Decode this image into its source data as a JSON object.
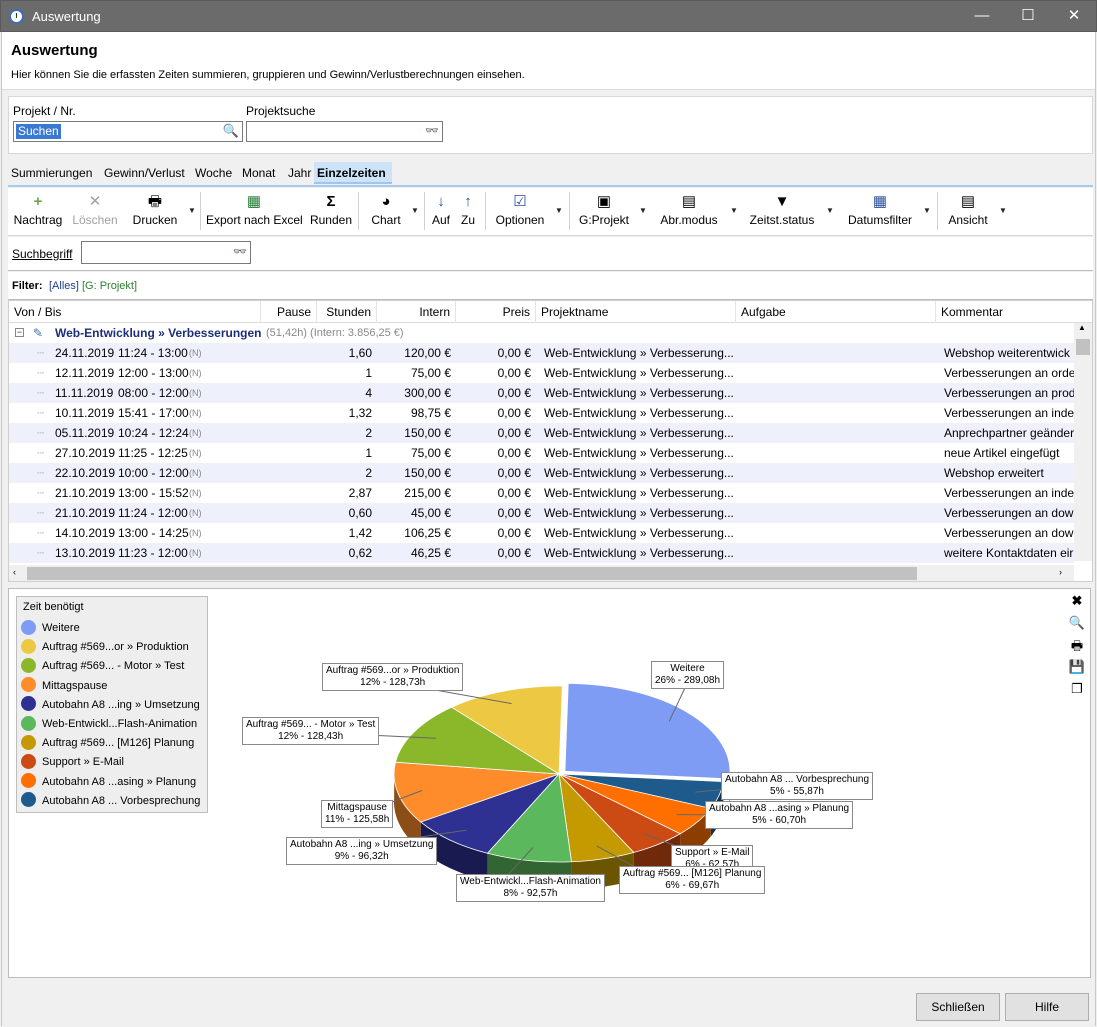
{
  "window": {
    "title": "Auswertung",
    "minimize": "—",
    "maximize": "☐",
    "close": "✕"
  },
  "header": {
    "title": "Auswertung",
    "subtitle": "Hier können Sie die erfassten Zeiten summieren, gruppieren und Gewinn/Verlustberechnungen einsehen."
  },
  "project": {
    "nr_label": "Projekt / Nr.",
    "nr_value": "Suchen",
    "search_label": "Projektsuche",
    "search_value": ""
  },
  "tabs": [
    "Summierungen",
    "Gewinn/Verlust",
    "Woche",
    "Monat",
    "Jahr",
    "Einzelzeiten"
  ],
  "active_tab": "Einzelzeiten",
  "toolbar": {
    "nachtrag": "Nachtrag",
    "loeschen": "Löschen",
    "drucken": "Drucken",
    "export": "Export nach Excel",
    "runden": "Runden",
    "chart": "Chart",
    "auf": "Auf",
    "zu": "Zu",
    "optionen": "Optionen",
    "gprojekt": "G:Projekt",
    "abrmodus": "Abr.modus",
    "zeitststatus": "Zeitst.status",
    "datumsfilter": "Datumsfilter",
    "ansicht": "Ansicht"
  },
  "search": {
    "label": "Suchbegriff",
    "value": ""
  },
  "filter": {
    "label": "Filter:",
    "all": "[Alles]",
    "group": "[G: Projekt]"
  },
  "grid": {
    "columns": [
      "Von / Bis",
      "Pause",
      "Stunden",
      "Intern",
      "Preis",
      "Projektname",
      "Aufgabe",
      "Kommentar"
    ],
    "group": {
      "title": "Web-Entwicklung » Verbesserungen",
      "summary": "(51,42h) (Intern: 3.856,25 €)"
    },
    "rows": [
      {
        "date": "24.11.2019",
        "time": "11:24 - 13:00",
        "flag": "(N)",
        "stunden": "1,60",
        "intern": "120,00 €",
        "preis": "0,00 €",
        "projekt": "Web-Entwicklung » Verbesserung...",
        "kommentar": "Webshop weiterentwick"
      },
      {
        "date": "12.11.2019",
        "time": "12:00 - 13:00",
        "flag": "(N)",
        "stunden": "1",
        "intern": "75,00 €",
        "preis": "0,00 €",
        "projekt": "Web-Entwicklung » Verbesserung...",
        "kommentar": "Verbesserungen an order"
      },
      {
        "date": "11.11.2019",
        "time": "08:00 - 12:00",
        "flag": "(N)",
        "stunden": "4",
        "intern": "300,00 €",
        "preis": "0,00 €",
        "projekt": "Web-Entwicklung » Verbesserung...",
        "kommentar": "Verbesserungen an prod"
      },
      {
        "date": "10.11.2019",
        "time": "15:41 - 17:00",
        "flag": "(N)",
        "stunden": "1,32",
        "intern": "98,75 €",
        "preis": "0,00 €",
        "projekt": "Web-Entwicklung » Verbesserung...",
        "kommentar": "Verbesserungen an index"
      },
      {
        "date": "05.11.2019",
        "time": "10:24 - 12:24",
        "flag": "(N)",
        "stunden": "2",
        "intern": "150,00 €",
        "preis": "0,00 €",
        "projekt": "Web-Entwicklung » Verbesserung...",
        "kommentar": "Anprechpartner geänder"
      },
      {
        "date": "27.10.2019",
        "time": "11:25 - 12:25",
        "flag": "(N)",
        "stunden": "1",
        "intern": "75,00 €",
        "preis": "0,00 €",
        "projekt": "Web-Entwicklung » Verbesserung...",
        "kommentar": "neue Artikel eingefügt"
      },
      {
        "date": "22.10.2019",
        "time": "10:00 - 12:00",
        "flag": "(N)",
        "stunden": "2",
        "intern": "150,00 €",
        "preis": "0,00 €",
        "projekt": "Web-Entwicklung » Verbesserung...",
        "kommentar": "Webshop erweitert"
      },
      {
        "date": "21.10.2019",
        "time": "13:00 - 15:52",
        "flag": "(N)",
        "stunden": "2,87",
        "intern": "215,00 €",
        "preis": "0,00 €",
        "projekt": "Web-Entwicklung » Verbesserung...",
        "kommentar": "Verbesserungen an index"
      },
      {
        "date": "21.10.2019",
        "time": "11:24 - 12:00",
        "flag": "(N)",
        "stunden": "0,60",
        "intern": "45,00 €",
        "preis": "0,00 €",
        "projekt": "Web-Entwicklung » Verbesserung...",
        "kommentar": "Verbesserungen an down"
      },
      {
        "date": "14.10.2019",
        "time": "13:00 - 14:25",
        "flag": "(N)",
        "stunden": "1,42",
        "intern": "106,25 €",
        "preis": "0,00 €",
        "projekt": "Web-Entwicklung » Verbesserung...",
        "kommentar": "Verbesserungen an down"
      },
      {
        "date": "13.10.2019",
        "time": "11:23 - 12:00",
        "flag": "(N)",
        "stunden": "0,62",
        "intern": "46,25 €",
        "preis": "0,00 €",
        "projekt": "Web-Entwicklung » Verbesserung...",
        "kommentar": "weitere Kontaktdaten eir"
      }
    ]
  },
  "chart_data": {
    "type": "pie",
    "title": "Zeit benötigt",
    "legend": "left",
    "slices": [
      {
        "name": "Weitere",
        "label": "Weitere",
        "percent_text": "26% - 289,08h",
        "value": 289.08,
        "color": "#7f9cf5"
      },
      {
        "name": "Autobahn A8 ... Vorbesprechung",
        "label": "Autobahn A8 ... Vorbesprechung",
        "percent_text": "5% - 55,87h",
        "value": 55.87,
        "color": "#1f5a8c"
      },
      {
        "name": "Autobahn A8 ...asing » Planung",
        "label": "Autobahn A8 ...asing » Planung",
        "percent_text": "5% - 60,70h",
        "value": 60.7,
        "color": "#ff6f00"
      },
      {
        "name": "Support » E-Mail",
        "label": "Support » E-Mail",
        "percent_text": "6% - 62,57h",
        "value": 62.57,
        "color": "#cc4a14"
      },
      {
        "name": "Auftrag #569... [M126] Planung",
        "label": "Auftrag #569... [M126] Planung",
        "percent_text": "6% - 69,67h",
        "value": 69.67,
        "color": "#c49a00"
      },
      {
        "name": "Web-Entwickl...Flash-Animation",
        "label": "Web-Entwickl...Flash-Animation",
        "percent_text": "8% - 92,57h",
        "value": 92.57,
        "color": "#5cb85c"
      },
      {
        "name": "Autobahn A8 ...ing » Umsetzung",
        "label": "Autobahn A8 ...ing » Umsetzung",
        "percent_text": "9% - 96,32h",
        "value": 96.32,
        "color": "#2e3192"
      },
      {
        "name": "Mittagspause",
        "label": "Mittagspause",
        "percent_text": "11% - 125,58h",
        "value": 125.58,
        "color": "#ff8c2a"
      },
      {
        "name": "Auftrag #569... - Motor » Test",
        "label": "Auftrag #569... - Motor » Test",
        "percent_text": "12% - 128,43h",
        "value": 128.43,
        "color": "#8bb82a"
      },
      {
        "name": "Auftrag #569...or » Produktion",
        "label": "Auftrag #569...or » Produktion",
        "percent_text": "12% - 128,73h",
        "value": 128.73,
        "color": "#ecc843"
      }
    ]
  },
  "legend_items": [
    {
      "label": "Weitere",
      "color": "#7f9cf5"
    },
    {
      "label": "Auftrag #569...or » Produktion",
      "color": "#ecc843"
    },
    {
      "label": "Auftrag #569... - Motor » Test",
      "color": "#8bb82a"
    },
    {
      "label": "Mittagspause",
      "color": "#ff8c2a"
    },
    {
      "label": "Autobahn A8 ...ing » Umsetzung",
      "color": "#2e3192"
    },
    {
      "label": "Web-Entwickl...Flash-Animation",
      "color": "#5cb85c"
    },
    {
      "label": "Auftrag #569... [M126] Planung",
      "color": "#c49a00"
    },
    {
      "label": "Support » E-Mail",
      "color": "#cc4a14"
    },
    {
      "label": "Autobahn A8 ...asing » Planung",
      "color": "#ff6f00"
    },
    {
      "label": "Autobahn A8 ... Vorbesprechung",
      "color": "#1f5a8c"
    }
  ],
  "buttons": {
    "close": "Schließen",
    "help": "Hilfe"
  }
}
